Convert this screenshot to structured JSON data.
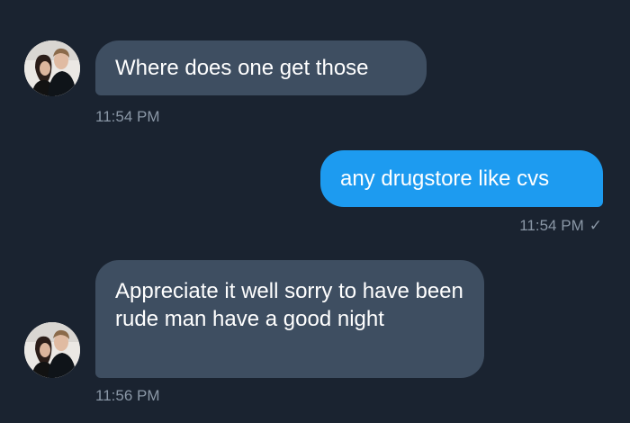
{
  "messages": [
    {
      "direction": "incoming",
      "text": "Where does one get those",
      "time": "11:54 PM"
    },
    {
      "direction": "outgoing",
      "text": "any drugstore like cvs",
      "time": "11:54 PM",
      "status_icon": "check-icon",
      "status_glyph": "✓"
    },
    {
      "direction": "incoming",
      "text": "Appreciate it well sorry to have been rude man have a good night",
      "time": "11:56 PM"
    }
  ],
  "colors": {
    "background": "#1a2330",
    "incoming_bubble": "#3e4e61",
    "outgoing_bubble": "#1d9bf0",
    "timestamp": "#8a97a6",
    "message_text": "#ffffff"
  }
}
